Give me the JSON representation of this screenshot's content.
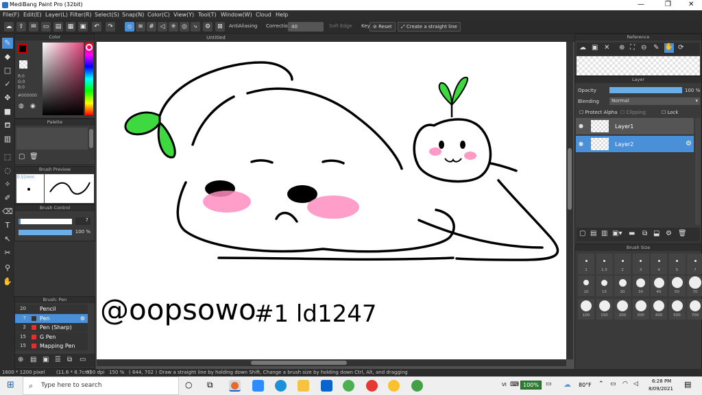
{
  "window": {
    "title": "MediBang Paint Pro (32bit)"
  },
  "menu": [
    "File(F)",
    "Edit(E)",
    "Layer(L)",
    "Filter(R)",
    "Select(S)",
    "Snap(N)",
    "Color(C)",
    "View(Y)",
    "Tool(T)",
    "Window(W)",
    "Cloud",
    "Help"
  ],
  "toolbar": {
    "antialiasing": "AntiAliasing",
    "correction_label": "Correction",
    "correction_value": "40",
    "soft_edge": "Soft Edge",
    "key": "Key",
    "reset": "Reset",
    "straight_line": "Create a straight line"
  },
  "panels": {
    "color": "Color",
    "palette": "Palette",
    "brush_preview": "Brush Preview",
    "brush_control": "Brush Control",
    "brush_list": "Brush: Pen",
    "reference": "Reference",
    "layer": "Layer",
    "brush_size": "Brush Size"
  },
  "color": {
    "r": "R:0",
    "g": "G:0",
    "b": "B:0",
    "hex": "#000000",
    "fg": "#000000"
  },
  "brush_preview": {
    "size": "0.51mm"
  },
  "brush_control": {
    "size": "7",
    "opacity": "100 %",
    "opacity_value": 1.0
  },
  "brushes": [
    {
      "size": "20",
      "name": "Pencil",
      "color": "#333333"
    },
    {
      "size": "7",
      "name": "Pen",
      "color": "#333333",
      "selected": true
    },
    {
      "size": "2",
      "name": "Pen (Sharp)",
      "color": "#e03030"
    },
    {
      "size": "15",
      "name": "G Pen",
      "color": "#e03030"
    },
    {
      "size": "15",
      "name": "Mapping Pen",
      "color": "#e03030"
    }
  ],
  "document": {
    "tab_title": "Untitled"
  },
  "layer": {
    "opacity_label": "Opacity",
    "opacity_value": "100 %",
    "blending_label": "Blending",
    "blending_value": "Normal",
    "protect_alpha": "Protect Alpha",
    "clipping": "Clipping",
    "lock": "Lock",
    "layers": [
      {
        "name": "Layer1",
        "selected": false
      },
      {
        "name": "Layer2",
        "selected": true
      }
    ]
  },
  "brush_sizes": {
    "row1": [
      "1",
      "1.5",
      "2",
      "3",
      "4",
      "5",
      "7"
    ],
    "row2": [
      "10",
      "15",
      "20",
      "30",
      "40",
      "50",
      "70"
    ],
    "row3": [
      "100",
      "150",
      "200",
      "300",
      "400",
      "500",
      "700"
    ]
  },
  "status": {
    "canvas_size": "1600 * 1200 pixel",
    "physical": "(11.6 * 8.7cm)",
    "dpi": "350 dpi",
    "zoom": "150 %",
    "coords": "( 644, 702 )",
    "hint": "Draw a straight line by holding down Shift, Change a brush size by holding down Ctrl, Alt, and dragging"
  },
  "artwork": {
    "signature": "@oopsowo",
    "tag": "#1 ld1247"
  },
  "taskbar": {
    "search_placeholder": "Type here to search",
    "battery": "100%",
    "weather": "80°F",
    "time": "6:28 PM",
    "date": "8/09/2021",
    "lang": "VI"
  }
}
